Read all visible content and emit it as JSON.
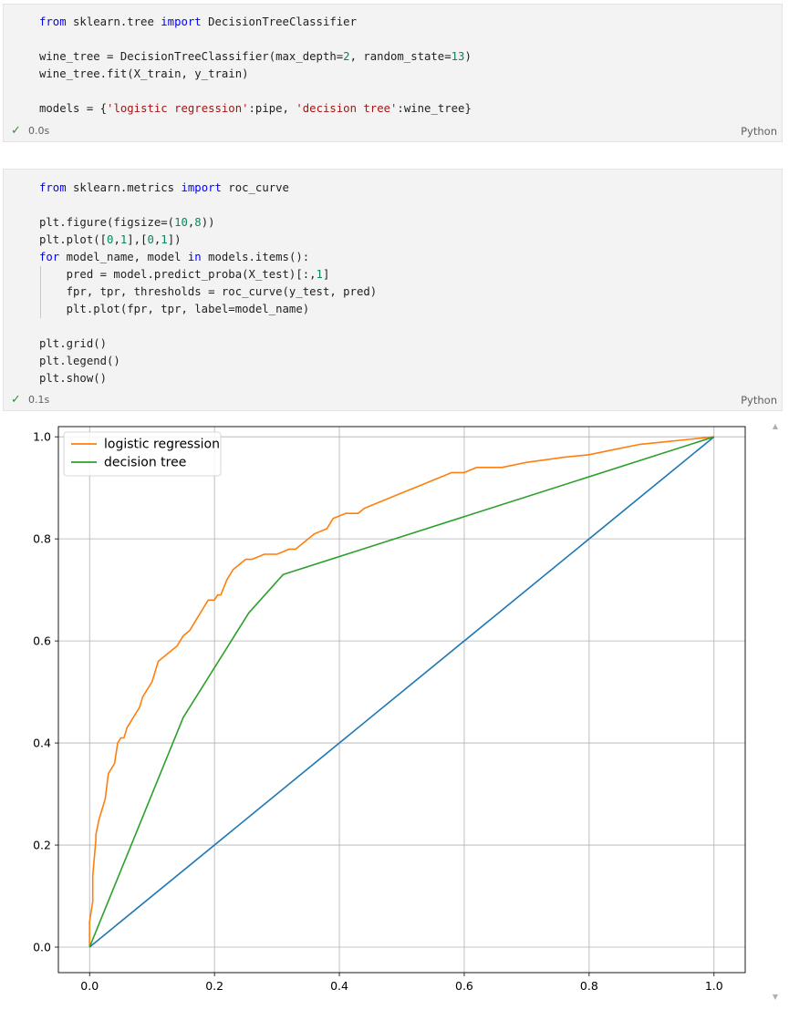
{
  "cells": [
    {
      "lines": [
        [
          [
            "kw",
            "from"
          ],
          [
            "t",
            " sklearn.tree "
          ],
          [
            "kw",
            "import"
          ],
          [
            "t",
            " DecisionTreeClassifier"
          ]
        ],
        [],
        [
          [
            "t",
            "wine_tree = DecisionTreeClassifier(max_depth="
          ],
          [
            "nm",
            "2"
          ],
          [
            "t",
            ", random_state="
          ],
          [
            "nm",
            "13"
          ],
          [
            "t",
            ")"
          ]
        ],
        [
          [
            "t",
            "wine_tree.fit(X_train, y_train)"
          ]
        ],
        [],
        [
          [
            "t",
            "models = {"
          ],
          [
            "st",
            "'logistic regression'"
          ],
          [
            "t",
            ":pipe, "
          ],
          [
            "st",
            "'decision tree'"
          ],
          [
            "t",
            ":wine_tree}"
          ]
        ]
      ],
      "status_icon": "check-icon",
      "exec_time": "0.0s",
      "language": "Python"
    },
    {
      "lines": [
        [
          [
            "kw",
            "from"
          ],
          [
            "t",
            " sklearn.metrics "
          ],
          [
            "kw",
            "import"
          ],
          [
            "t",
            " roc_curve"
          ]
        ],
        [],
        [
          [
            "t",
            "plt.figure(figsize=("
          ],
          [
            "nm",
            "10"
          ],
          [
            "t",
            ","
          ],
          [
            "nm",
            "8"
          ],
          [
            "t",
            "))"
          ]
        ],
        [
          [
            "t",
            "plt.plot(["
          ],
          [
            "nm",
            "0"
          ],
          [
            "t",
            ","
          ],
          [
            "nm",
            "1"
          ],
          [
            "t",
            "],["
          ],
          [
            "nm",
            "0"
          ],
          [
            "t",
            ","
          ],
          [
            "nm",
            "1"
          ],
          [
            "t",
            "])"
          ]
        ],
        [
          [
            "kw",
            "for"
          ],
          [
            "t",
            " model_name, model "
          ],
          [
            "kw",
            "in"
          ],
          [
            "t",
            " models.items():"
          ]
        ],
        [
          [
            "t",
            "    pred = model.predict_proba(X_test)[:,"
          ],
          [
            "nm",
            "1"
          ],
          [
            "t",
            "]"
          ]
        ],
        [
          [
            "t",
            "    fpr, tpr, thresholds = roc_curve(y_test, pred)"
          ]
        ],
        [
          [
            "t",
            "    plt.plot(fpr, tpr, label=model_name)"
          ]
        ],
        [],
        [
          [
            "t",
            "plt.grid()"
          ]
        ],
        [
          [
            "t",
            "plt.legend()"
          ]
        ],
        [
          [
            "t",
            "plt.show()"
          ]
        ]
      ],
      "status_icon": "check-icon",
      "exec_time": "0.1s",
      "language": "Python"
    }
  ],
  "colors": {
    "keyword": "#0000ff",
    "string": "#a31515",
    "number": "#098658",
    "success": "#3a8d3a"
  },
  "scrollbar": {
    "up_icon": "scroll-up-icon",
    "down_icon": "scroll-down-icon"
  },
  "chart_data": {
    "type": "line",
    "title": "",
    "xlabel": "",
    "ylabel": "",
    "xlim": [
      -0.05,
      1.05
    ],
    "ylim": [
      -0.05,
      1.02
    ],
    "x_ticks": [
      "0.0",
      "0.2",
      "0.4",
      "0.6",
      "0.8",
      "1.0"
    ],
    "y_ticks": [
      "0.0",
      "0.2",
      "0.4",
      "0.6",
      "0.8",
      "1.0"
    ],
    "grid": true,
    "legend_position": "top-left",
    "series": [
      {
        "name": "",
        "color": "#1f77b4",
        "x": [
          0,
          1
        ],
        "y": [
          0,
          1
        ]
      },
      {
        "name": "logistic regression",
        "color": "#ff7f0e",
        "x": [
          0,
          0.0,
          0.005,
          0.005,
          0.01,
          0.01,
          0.015,
          0.02,
          0.025,
          0.03,
          0.035,
          0.04,
          0.045,
          0.05,
          0.055,
          0.06,
          0.065,
          0.07,
          0.075,
          0.08,
          0.085,
          0.09,
          0.095,
          0.1,
          0.105,
          0.11,
          0.12,
          0.13,
          0.14,
          0.15,
          0.16,
          0.17,
          0.18,
          0.19,
          0.2,
          0.205,
          0.21,
          0.22,
          0.23,
          0.24,
          0.25,
          0.26,
          0.28,
          0.3,
          0.32,
          0.33,
          0.34,
          0.36,
          0.38,
          0.39,
          0.41,
          0.43,
          0.44,
          0.46,
          0.48,
          0.5,
          0.52,
          0.54,
          0.56,
          0.58,
          0.6,
          0.62,
          0.66,
          0.7,
          0.73,
          0.76,
          0.8,
          0.84,
          0.88,
          0.92,
          0.96,
          1.0
        ],
        "y": [
          0,
          0.05,
          0.09,
          0.14,
          0.21,
          0.22,
          0.25,
          0.27,
          0.29,
          0.34,
          0.35,
          0.36,
          0.4,
          0.41,
          0.41,
          0.43,
          0.44,
          0.45,
          0.46,
          0.47,
          0.49,
          0.5,
          0.51,
          0.52,
          0.54,
          0.56,
          0.57,
          0.58,
          0.59,
          0.61,
          0.62,
          0.64,
          0.66,
          0.68,
          0.68,
          0.69,
          0.69,
          0.72,
          0.74,
          0.75,
          0.76,
          0.76,
          0.77,
          0.77,
          0.78,
          0.78,
          0.79,
          0.81,
          0.82,
          0.84,
          0.85,
          0.85,
          0.86,
          0.87,
          0.88,
          0.89,
          0.9,
          0.91,
          0.92,
          0.93,
          0.93,
          0.94,
          0.94,
          0.95,
          0.955,
          0.96,
          0.965,
          0.975,
          0.985,
          0.99,
          0.995,
          1.0
        ]
      },
      {
        "name": "decision tree",
        "color": "#2ca02c",
        "x": [
          0,
          0.15,
          0.255,
          0.31,
          1.0
        ],
        "y": [
          0,
          0.45,
          0.655,
          0.73,
          1.0
        ]
      }
    ]
  }
}
